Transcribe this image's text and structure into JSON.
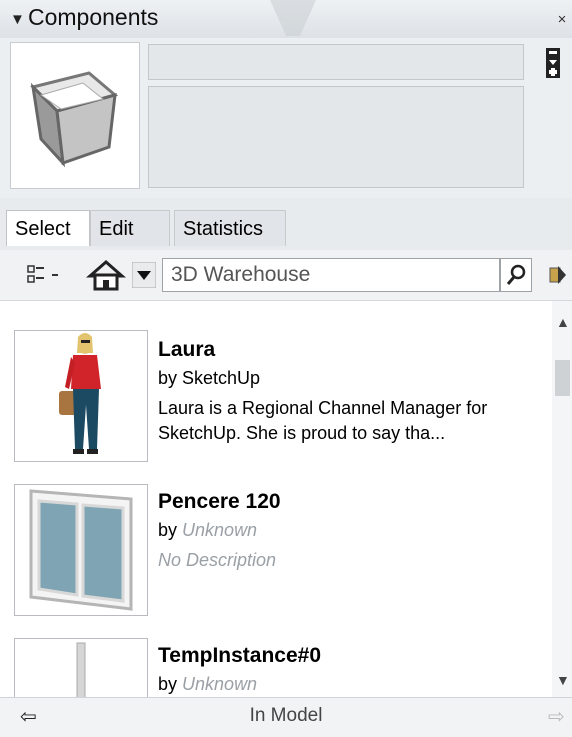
{
  "panel": {
    "title": "Components",
    "collapse_glyph": "▼",
    "close_glyph": "×",
    "header_icons": [
      "collapse-triangle-icon",
      "close-icon",
      "details-arrow-icon"
    ]
  },
  "info": {
    "name_value": "",
    "description_value": ""
  },
  "tabs": [
    {
      "label": "Select",
      "active": true
    },
    {
      "label": "Edit",
      "active": false
    },
    {
      "label": "Statistics",
      "active": false
    }
  ],
  "toolbar": {
    "icons": [
      "view-options-icon",
      "home-icon",
      "dropdown-arrow-icon",
      "search-icon",
      "navigate-icon"
    ],
    "search_value": "3D Warehouse"
  },
  "items": [
    {
      "title": "Laura",
      "by_prefix": "by",
      "author": "SketchUp",
      "description": "Laura is a Regional Channel Manager for SketchUp. She is proud to say tha...",
      "thumb": "person-thumbnail"
    },
    {
      "title": "Pencere 120",
      "by_prefix": "by",
      "author": "Unknown",
      "description": "No Description",
      "thumb": "window-thumbnail"
    },
    {
      "title": "TempInstance#0",
      "by_prefix": "by",
      "author": "Unknown",
      "description": "",
      "thumb": "pole-thumbnail"
    }
  ],
  "footer": {
    "label": "In Model",
    "icons": [
      "back-arrow-icon",
      "forward-arrow-icon"
    ]
  },
  "colors": {
    "panel_bg": "#eceff2",
    "list_bg": "#ffffff",
    "muted_text": "#9aa0a6"
  }
}
